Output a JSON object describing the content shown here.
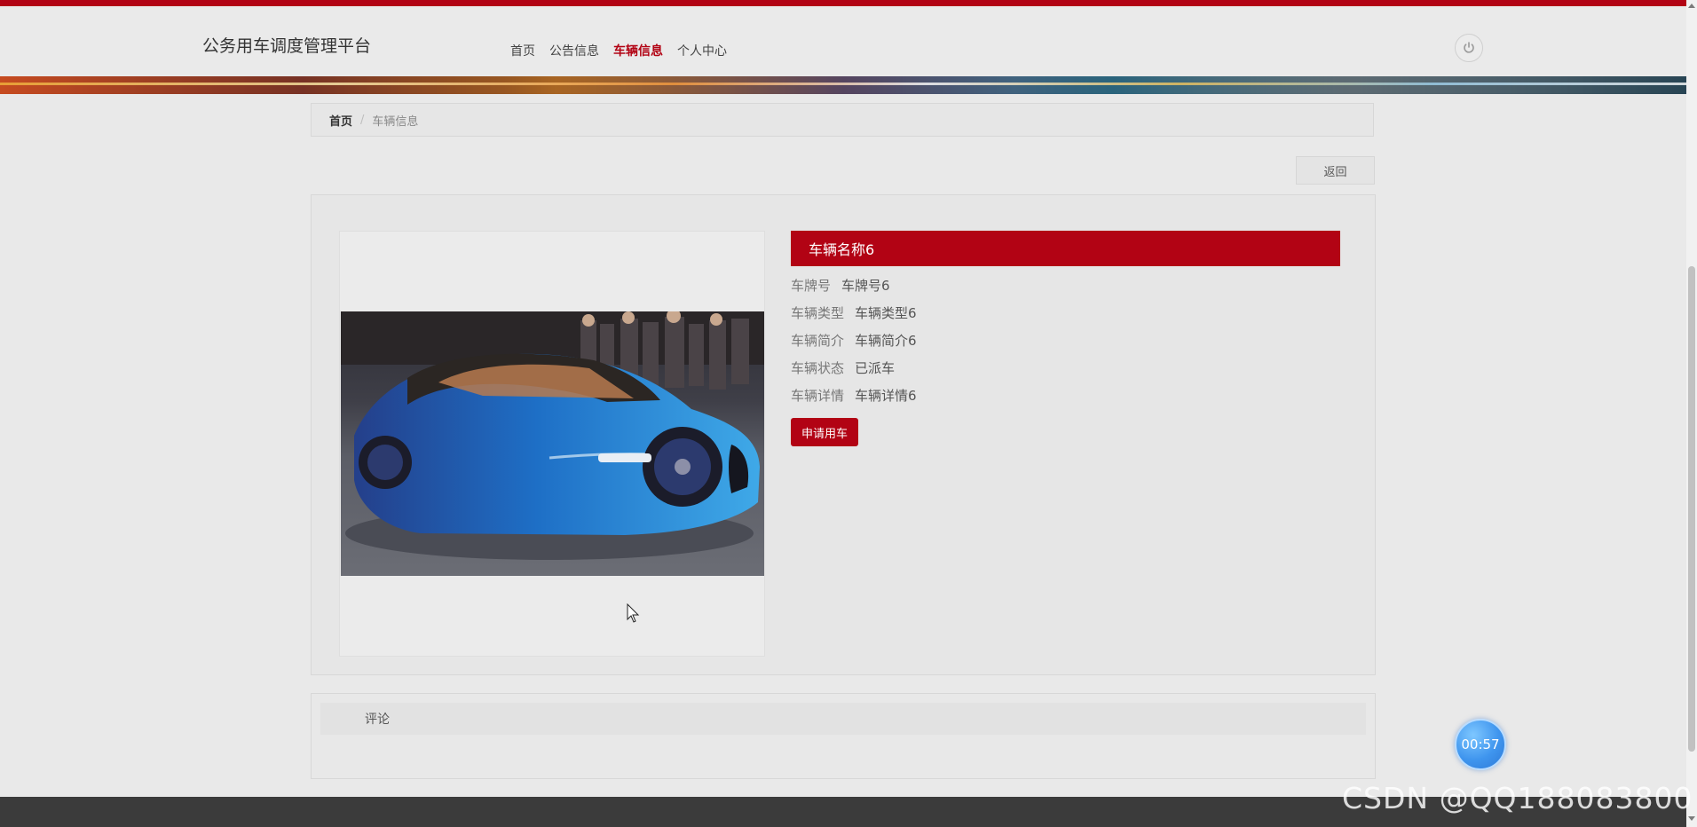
{
  "header": {
    "site_title": "公务用车调度管理平台",
    "nav": [
      {
        "label": "首页",
        "active": false
      },
      {
        "label": "公告信息",
        "active": false
      },
      {
        "label": "车辆信息",
        "active": true
      },
      {
        "label": "个人中心",
        "active": false
      }
    ],
    "power_icon": "power-icon"
  },
  "breadcrumb": {
    "home": "首页",
    "separator": "/",
    "current": "车辆信息"
  },
  "back_button": "返回",
  "vehicle": {
    "name": "车辆名称6",
    "fields": [
      {
        "label": "车牌号",
        "value": "车牌号6"
      },
      {
        "label": "车辆类型",
        "value": "车辆类型6"
      },
      {
        "label": "车辆简介",
        "value": "车辆简介6"
      },
      {
        "label": "车辆状态",
        "value": "已派车"
      },
      {
        "label": "车辆详情",
        "value": "车辆详情6"
      }
    ],
    "apply_button": "申请用车"
  },
  "comments": {
    "title": "评论"
  },
  "overlay": {
    "timer": "00:57",
    "watermark": "CSDN @QQ188083800"
  },
  "colors": {
    "accent": "#b20314",
    "background": "#e9e9e9",
    "footer": "#3b3b3b",
    "timer": "#3f95ee"
  }
}
